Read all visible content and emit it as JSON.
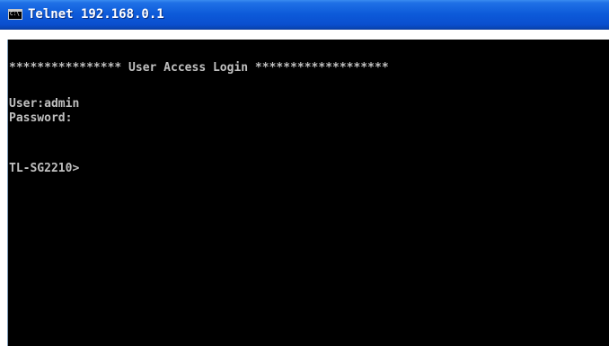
{
  "window": {
    "title": "Telnet 192.168.0.1",
    "icon": "console-icon",
    "icon_text": "C:\\"
  },
  "console": {
    "banner": "**************** User Access Login *******************",
    "user_line": "User:admin",
    "password_line": "Password:",
    "prompt": "TL-SG2210>"
  },
  "colors": {
    "titlebar": "#0c5ad9",
    "console_background": "#000000",
    "console_text": "#c0c0c0"
  }
}
